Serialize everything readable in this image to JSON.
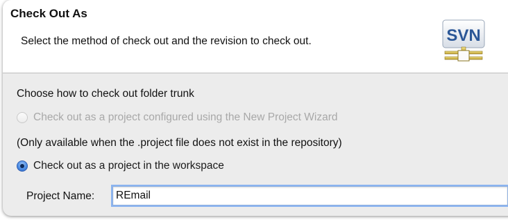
{
  "dialog": {
    "title": "Check Out As",
    "description": "Select the method of check out and the revision to check out.",
    "logo_text": "SVN"
  },
  "checkout": {
    "prompt": "Choose how to check out folder trunk",
    "option_wizard": {
      "label": "Check out as a project configured using the New Project Wizard",
      "enabled": false,
      "selected": false
    },
    "wizard_note": "(Only available when the .project file does not exist in the repository)",
    "option_workspace": {
      "label": "Check out as a project in the workspace",
      "enabled": true,
      "selected": true
    },
    "project_name_label": "Project Name:",
    "project_name_value": "REmail"
  },
  "colors": {
    "accent": "#4e8ee4",
    "logo_blue": "#2b5797",
    "focus_ring": "#8bb4f0"
  }
}
